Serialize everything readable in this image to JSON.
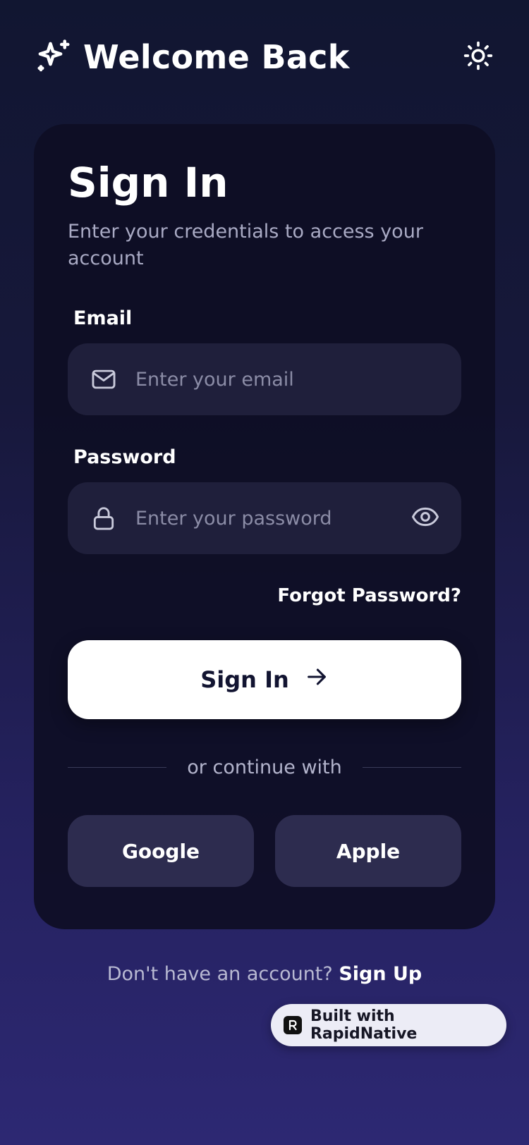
{
  "header": {
    "brand_icon": "sparkles-icon",
    "title": "Welcome Back",
    "theme_icon": "sun-icon"
  },
  "card": {
    "title": "Sign In",
    "subtitle": "Enter your credentials to access your account",
    "email": {
      "label": "Email",
      "icon": "mail-icon",
      "placeholder": "Enter your email",
      "value": ""
    },
    "password": {
      "label": "Password",
      "icon": "lock-icon",
      "placeholder": "Enter your password",
      "value": "",
      "toggle_icon": "eye-icon"
    },
    "forgot_label": "Forgot Password?",
    "signin_label": "Sign In",
    "signin_icon": "arrow-right-icon",
    "divider_text": "or continue with",
    "social": [
      "Google",
      "Apple"
    ]
  },
  "footer": {
    "signup_prompt": "Don't have an account?",
    "signup_link": "Sign Up"
  },
  "badge": {
    "label": "Built with RapidNative"
  },
  "colors": {
    "background_top": "#111631",
    "background_bottom": "#2d2873",
    "card": "#0e0e24",
    "input": "#1f1f3b",
    "social_button": "#2d2c4f",
    "primary_button": "#ffffff",
    "primary_button_text": "#121431",
    "muted_text": "#a9aac4"
  }
}
